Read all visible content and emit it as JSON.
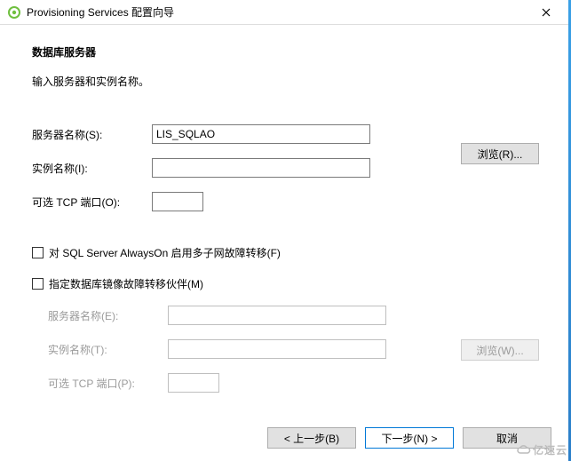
{
  "titlebar": {
    "title": "Provisioning Services 配置向导",
    "close_tooltip": "Close"
  },
  "main": {
    "heading": "数据库服务器",
    "subtext": "输入服务器和实例名称。",
    "server_name_label": "服务器名称(S):",
    "server_name_value": "LIS_SQLAO",
    "instance_name_label": "实例名称(I):",
    "instance_name_value": "",
    "tcp_port_label": "可选 TCP 端口(O):",
    "tcp_port_value": "",
    "browse_btn": "浏览(R)...",
    "chk_alwayson": "对 SQL Server AlwaysOn 启用多子网故障转移(F)",
    "chk_mirror": "指定数据库镜像故障转移伙伴(M)",
    "mirror": {
      "server_name_label": "服务器名称(E):",
      "instance_name_label": "实例名称(T):",
      "tcp_port_label": "可选 TCP 端口(P):",
      "browse_btn": "浏览(W)..."
    }
  },
  "footer": {
    "back": "< 上一步(B)",
    "next": "下一步(N) >",
    "cancel": "取消"
  },
  "watermark": "亿速云"
}
